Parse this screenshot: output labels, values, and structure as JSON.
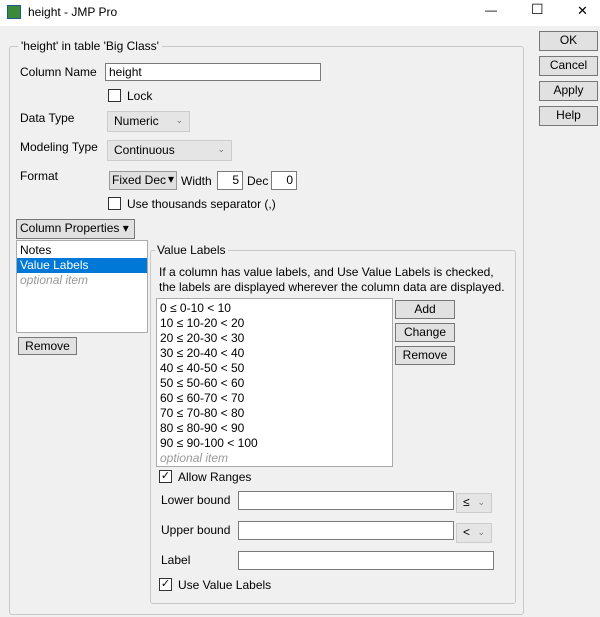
{
  "window": {
    "title": "height - JMP Pro",
    "minimize": "—",
    "maximize": "☐",
    "close": "✕"
  },
  "group_title": "'height' in table 'Big Class'",
  "column_name": {
    "label": "Column Name",
    "value": "height"
  },
  "lock": {
    "label": "Lock",
    "checked": false
  },
  "data_type": {
    "label": "Data Type",
    "value": "Numeric"
  },
  "modeling_type": {
    "label": "Modeling Type",
    "value": "Continuous"
  },
  "format": {
    "label": "Format",
    "value": "Fixed Dec",
    "width_label": "Width",
    "width": "5",
    "dec_label": "Dec",
    "dec": "0"
  },
  "thousands": {
    "label": "Use thousands separator (,)",
    "checked": false
  },
  "column_properties": {
    "label": "Column Properties",
    "items": [
      "Notes",
      "Value Labels",
      "optional item"
    ],
    "remove": "Remove"
  },
  "value_labels": {
    "title": "Value Labels",
    "description": "If a column has value labels, and Use Value Labels is checked, the labels are displayed wherever the column data are displayed.",
    "items": [
      "0 ≤ 0-10 < 10",
      "10 ≤ 10-20 < 20",
      "20 ≤ 20-30 < 30",
      "30 ≤ 20-40 < 40",
      "40 ≤ 40-50 < 50",
      "50 ≤ 50-60 < 60",
      "60 ≤ 60-70 < 70",
      "70 ≤ 70-80 < 80",
      "80 ≤ 80-90 < 90",
      "90 ≤ 90-100 < 100"
    ],
    "optional": "optional item",
    "add": "Add",
    "change": "Change",
    "remove": "Remove",
    "allow_ranges": "Allow Ranges",
    "lower_bound": "Lower bound",
    "lower_op": "≤",
    "upper_bound": "Upper bound",
    "upper_op": "<",
    "label": "Label",
    "use_value_labels": "Use Value Labels"
  },
  "buttons": {
    "ok": "OK",
    "cancel": "Cancel",
    "apply": "Apply",
    "help": "Help"
  },
  "check": "✓",
  "dropdown": "▾",
  "chevron": "⌄"
}
